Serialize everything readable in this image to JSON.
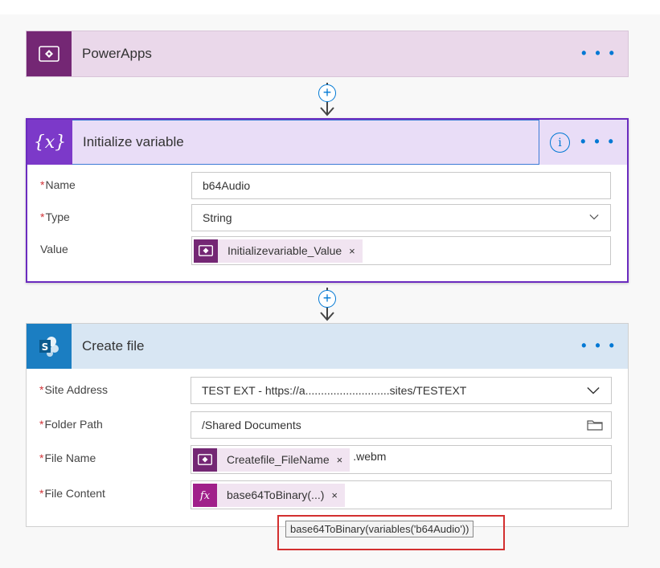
{
  "trigger": {
    "title": "PowerApps",
    "menu": "• • •"
  },
  "init_variable": {
    "title": "Initialize variable",
    "info": "i",
    "menu": "• • •",
    "name_label": "Name",
    "name_value": "b64Audio",
    "type_label": "Type",
    "type_value": "String",
    "value_label": "Value",
    "value_token": "Initializevariable_Value",
    "token_remove": "×"
  },
  "create_file": {
    "title": "Create file",
    "menu": "• • •",
    "site_label": "Site Address",
    "site_value": "TEST EXT - https://a...........................sites/TESTEXT",
    "folder_label": "Folder Path",
    "folder_value": "/Shared Documents",
    "filename_label": "File Name",
    "filename_token": "Createfile_FileName",
    "filename_suffix": ".webm",
    "content_label": "File Content",
    "content_token": "base64ToBinary(...)",
    "token_remove": "×"
  },
  "connector": {
    "plus": "+"
  },
  "required_mark": "*",
  "tooltip": "base64ToBinary(variables('b64Audio'))",
  "colors": {
    "powerapps": "#742774",
    "variable": "#7c39c9",
    "sharepoint": "#1b7ec2",
    "accent": "#0078d4",
    "highlight": "#d32f2f"
  },
  "icons": {
    "trigger": "powerapps-icon",
    "variable": "variable-braces-icon",
    "create": "sharepoint-icon"
  }
}
